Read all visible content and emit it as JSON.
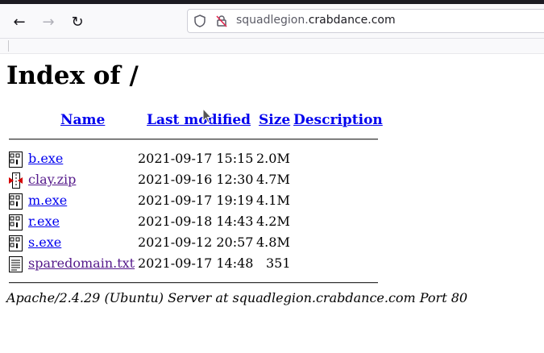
{
  "browser": {
    "url_subdomain": "squadlegion.",
    "url_domain": "crabdance.com",
    "back_icon": "←",
    "forward_icon": "→",
    "reload_icon": "↻"
  },
  "page": {
    "title": "Index of /",
    "columns": {
      "name": "Name",
      "last_modified": "Last modified",
      "size": "Size",
      "description": "Description"
    },
    "files": [
      {
        "name": "b.exe",
        "modified": "2021-09-17 15:15",
        "size": "2.0M",
        "type": "binary"
      },
      {
        "name": "clay.zip",
        "modified": "2021-09-16 12:30",
        "size": "4.7M",
        "type": "compressed"
      },
      {
        "name": "m.exe",
        "modified": "2021-09-17 19:19",
        "size": "4.1M",
        "type": "binary"
      },
      {
        "name": "r.exe",
        "modified": "2021-09-18 14:43",
        "size": "4.2M",
        "type": "binary"
      },
      {
        "name": "s.exe",
        "modified": "2021-09-12 20:57",
        "size": "4.8M",
        "type": "binary"
      },
      {
        "name": "sparedomain.txt",
        "modified": "2021-09-17 14:48",
        "size": "351",
        "type": "text"
      }
    ],
    "footer": "Apache/2.4.29 (Ubuntu) Server at squadlegion.crabdance.com Port 80"
  }
}
